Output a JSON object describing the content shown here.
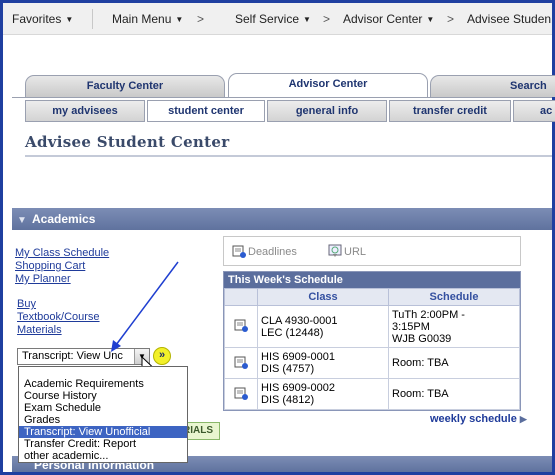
{
  "topnav": {
    "items": [
      {
        "label": "Favorites",
        "has_menu": true
      },
      {
        "label": "Main Menu",
        "has_menu": true
      },
      {
        "label": "Self Service",
        "has_menu": true
      },
      {
        "label": "Advisor Center",
        "has_menu": true
      },
      {
        "label": "Advisee Studen",
        "has_menu": false
      }
    ],
    "dropdown_glyph": "▼",
    "separator_glyph": ">"
  },
  "tabs": [
    {
      "label": "Faculty Center",
      "active": false
    },
    {
      "label": "Advisor Center",
      "active": true
    },
    {
      "label": "Search",
      "active": false
    }
  ],
  "subtabs": [
    {
      "label": "my advisees",
      "active": false
    },
    {
      "label": "student center",
      "active": true
    },
    {
      "label": "general info",
      "active": false
    },
    {
      "label": "transfer credit",
      "active": false
    },
    {
      "label": "ac",
      "active": false
    }
  ],
  "page_title": "Advisee Student Center",
  "academics": {
    "section_title": "Academics",
    "links": {
      "class_schedule": "My Class Schedule",
      "shopping_cart": "Shopping Cart",
      "planner": "My Planner",
      "buy": "Buy",
      "textbook": "Textbook/Course",
      "materials": "Materials"
    },
    "select_value": "Transcript: View Unc",
    "go_glyph": "»",
    "dropdown_options": [
      {
        "label": "Academic Requirements",
        "selected": false
      },
      {
        "label": "Course History",
        "selected": false
      },
      {
        "label": "Exam Schedule",
        "selected": false
      },
      {
        "label": "Grades",
        "selected": false
      },
      {
        "label": "Transcript: View Unofficial",
        "selected": true
      },
      {
        "label": "Transfer Credit: Report",
        "selected": false
      },
      {
        "label": "other academic...",
        "selected": false
      }
    ],
    "partial_button": "RIALS"
  },
  "personal_section": "Personal Information",
  "deadlines": {
    "deadlines_label": "Deadlines",
    "url_label": "URL"
  },
  "schedule": {
    "title": "This Week's Schedule",
    "columns": [
      "Class",
      "Schedule"
    ],
    "rows": [
      {
        "class_line1": "CLA 4930-0001",
        "class_line2": "LEC (12448)",
        "sched_line1": "TuTh 2:00PM -",
        "sched_line2": "3:15PM",
        "sched_line3": "WJB G0039"
      },
      {
        "class_line1": "HIS 6909-0001",
        "class_line2": "DIS (4757)",
        "sched_line1": "Room:  TBA",
        "sched_line2": "",
        "sched_line3": ""
      },
      {
        "class_line1": "HIS 6909-0002",
        "class_line2": "DIS (4812)",
        "sched_line1": "Room:  TBA",
        "sched_line2": "",
        "sched_line3": ""
      }
    ],
    "weekly_link": "weekly schedule",
    "weekly_glyph": "▶"
  },
  "colors": {
    "frame": "#1f3fa0",
    "section_bar": "#6a7ca8",
    "link": "#1f3b9a",
    "selected_option": "#3d64c2",
    "go_button": "#f2f02a",
    "annotation_arrow": "#1f3fd0"
  }
}
